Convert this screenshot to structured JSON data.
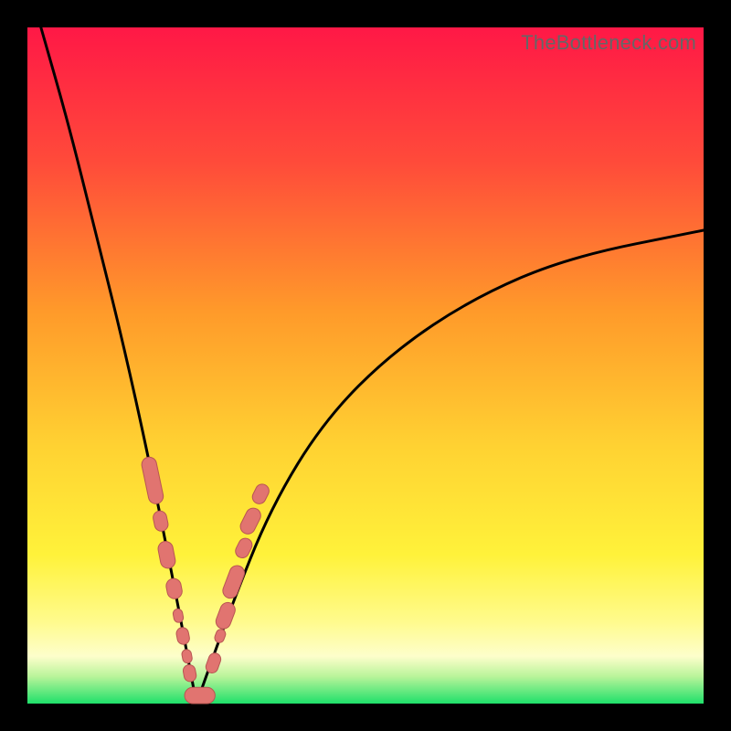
{
  "watermark": "TheBottleneck.com",
  "colors": {
    "frame": "#000000",
    "gradient_top": "#ff1846",
    "gradient_mid1": "#ff8a2a",
    "gradient_mid2": "#ffe83a",
    "gradient_mid3": "#fffb9c",
    "gradient_bottom": "#1fe06a",
    "curve": "#000000",
    "blob_fill": "#e17470",
    "blob_stroke": "#b95652"
  },
  "chart_data": {
    "type": "line",
    "title": "",
    "xlabel": "",
    "ylabel": "",
    "xlim": [
      0,
      100
    ],
    "ylim": [
      0,
      100
    ],
    "vertex_x": 25,
    "vertex_y": 0,
    "left_top_y": 100,
    "right_top_y_at_x100": 70,
    "points_left_arm": [
      {
        "x": 2,
        "y": 100
      },
      {
        "x": 6,
        "y": 86
      },
      {
        "x": 10,
        "y": 70
      },
      {
        "x": 14,
        "y": 54
      },
      {
        "x": 18,
        "y": 36
      },
      {
        "x": 22,
        "y": 16
      },
      {
        "x": 25,
        "y": 0
      }
    ],
    "points_right_arm": [
      {
        "x": 25,
        "y": 0
      },
      {
        "x": 30,
        "y": 14
      },
      {
        "x": 36,
        "y": 29
      },
      {
        "x": 44,
        "y": 42
      },
      {
        "x": 54,
        "y": 52
      },
      {
        "x": 66,
        "y": 60
      },
      {
        "x": 80,
        "y": 66
      },
      {
        "x": 100,
        "y": 70
      }
    ],
    "blobs": [
      {
        "arm": "left",
        "x": 18.5,
        "y": 33,
        "len": 7,
        "w": 2.2
      },
      {
        "arm": "left",
        "x": 19.7,
        "y": 27,
        "len": 3,
        "w": 2.0
      },
      {
        "arm": "left",
        "x": 20.6,
        "y": 22,
        "len": 4,
        "w": 2.2
      },
      {
        "arm": "left",
        "x": 21.7,
        "y": 17,
        "len": 3,
        "w": 2.2
      },
      {
        "arm": "left",
        "x": 22.3,
        "y": 13,
        "len": 2,
        "w": 1.4
      },
      {
        "arm": "left",
        "x": 23.0,
        "y": 10,
        "len": 2.5,
        "w": 1.8
      },
      {
        "arm": "left",
        "x": 23.6,
        "y": 7,
        "len": 2,
        "w": 1.4
      },
      {
        "arm": "left",
        "x": 24.0,
        "y": 4.5,
        "len": 2.5,
        "w": 1.8
      },
      {
        "arm": "bottom",
        "x": 25.5,
        "y": 1.2,
        "len": 4.5,
        "w": 2.4
      },
      {
        "arm": "right",
        "x": 27.5,
        "y": 6,
        "len": 3,
        "w": 1.8
      },
      {
        "arm": "right",
        "x": 28.5,
        "y": 10,
        "len": 2,
        "w": 1.4
      },
      {
        "arm": "right",
        "x": 29.3,
        "y": 13,
        "len": 4,
        "w": 2.2
      },
      {
        "arm": "right",
        "x": 30.5,
        "y": 18,
        "len": 5,
        "w": 2.2
      },
      {
        "arm": "right",
        "x": 32.0,
        "y": 23,
        "len": 3,
        "w": 2.0
      },
      {
        "arm": "right",
        "x": 33.0,
        "y": 27,
        "len": 4,
        "w": 2.2
      },
      {
        "arm": "right",
        "x": 34.5,
        "y": 31,
        "len": 3,
        "w": 2.0
      }
    ]
  }
}
